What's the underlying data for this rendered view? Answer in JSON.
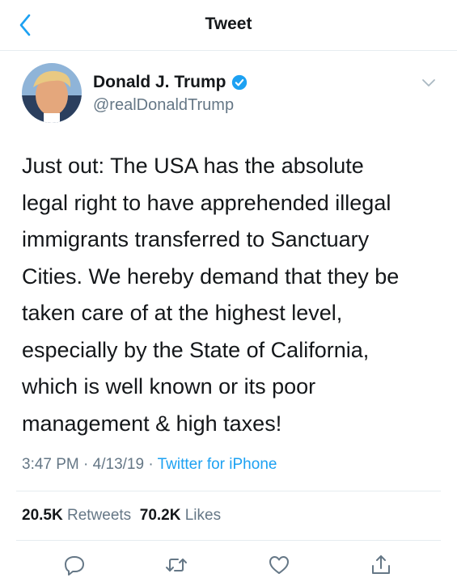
{
  "nav": {
    "title": "Tweet"
  },
  "tweet": {
    "author_name": "Donald J. Trump",
    "author_handle": "@realDonaldTrump",
    "lines": [
      "Just out: The USA has the absolute",
      "legal right to have apprehended illegal",
      "immigrants transferred to Sanctuary",
      "Cities. We hereby demand that they be",
      "taken care of at the highest level,",
      "especially by the State of California,",
      "which is well known or its poor",
      "management & high taxes!"
    ],
    "time": "3:47 PM",
    "date": "4/13/19",
    "separator": "·",
    "source": "Twitter for iPhone",
    "retweet_count": "20.5K",
    "retweet_label": "Retweets",
    "like_count": "70.2K",
    "like_label": "Likes"
  },
  "colors": {
    "accent": "#1da1f2",
    "secondary_text": "#657786",
    "icon": "#657786",
    "divider": "#e6ecf0"
  },
  "icons": {
    "back": "chevron-left-icon",
    "verified": "verified-badge-icon",
    "more": "chevron-down-icon",
    "reply": "reply-icon",
    "retweet": "retweet-icon",
    "like": "heart-icon",
    "share": "share-icon"
  }
}
